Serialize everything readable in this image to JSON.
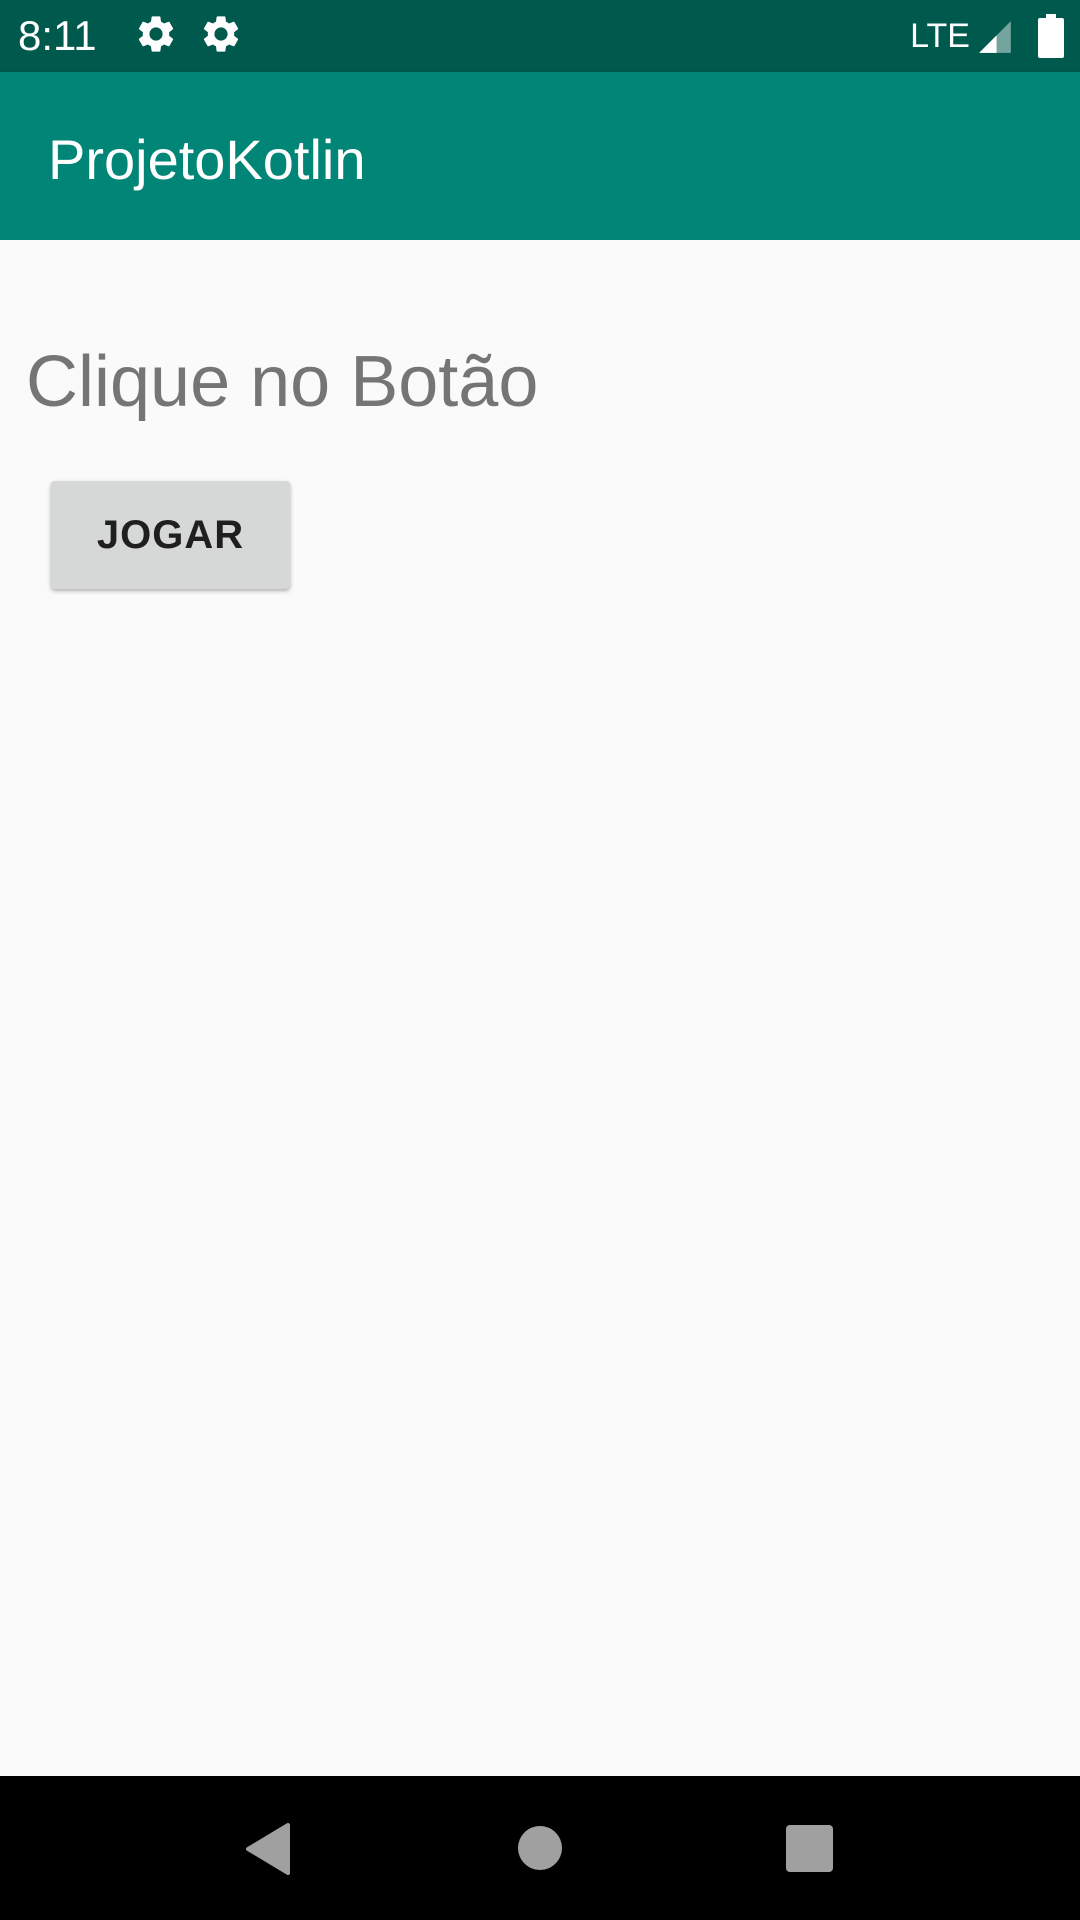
{
  "status_bar": {
    "time": "8:11",
    "network": "LTE",
    "icons": [
      "settings-gear-icon",
      "settings-gear-icon",
      "cell-signal-icon",
      "battery-icon"
    ]
  },
  "app_bar": {
    "title": "ProjetoKotlin"
  },
  "main": {
    "prompt": "Clique no Botão",
    "play_button_label": "JOGAR"
  },
  "nav_bar": {
    "icons": [
      "back-icon",
      "home-icon",
      "recents-icon"
    ]
  },
  "colors": {
    "status_bar": "#00594d",
    "app_bar": "#008577",
    "background": "#fafafa",
    "button": "#d6d7d7",
    "prompt_text": "#757575",
    "nav_bar": "#000000"
  }
}
